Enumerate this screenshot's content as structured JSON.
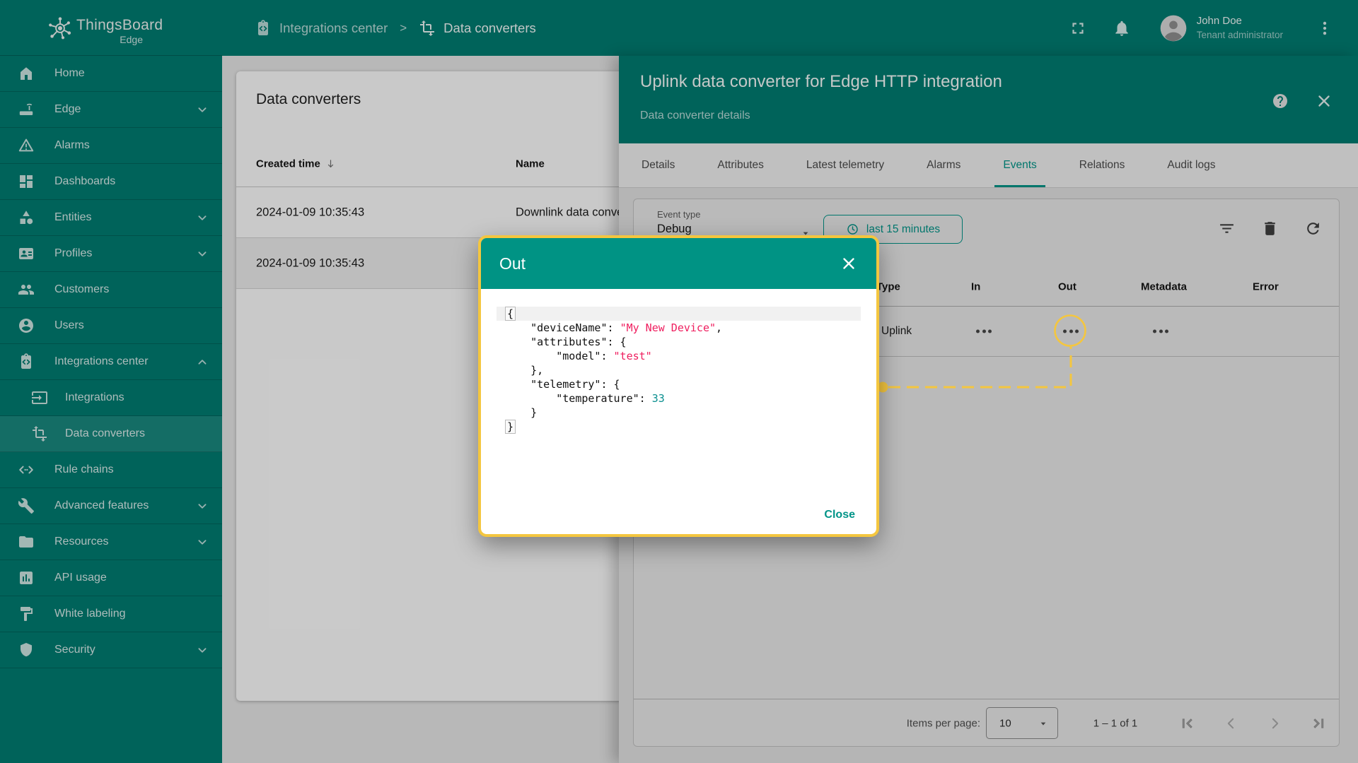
{
  "colors": {
    "primary_teal": "#007c71",
    "accent_teal": "#009488",
    "highlight_yellow": "#f4c63f",
    "json_string_color": "#ef1d5e",
    "json_number_color": "#0a8f8f"
  },
  "sidebar": {
    "logo": {
      "title": "ThingsBoard",
      "subtitle": "Edge"
    },
    "items": [
      {
        "label": "Home",
        "icon": "home"
      },
      {
        "label": "Edge",
        "icon": "edge-device",
        "chevron": "down"
      },
      {
        "label": "Alarms",
        "icon": "warning"
      },
      {
        "label": "Dashboards",
        "icon": "dashboards"
      },
      {
        "label": "Entities",
        "icon": "entities",
        "chevron": "down"
      },
      {
        "label": "Profiles",
        "icon": "profiles",
        "chevron": "down"
      },
      {
        "label": "Customers",
        "icon": "customers"
      },
      {
        "label": "Users",
        "icon": "user"
      },
      {
        "label": "Integrations center",
        "icon": "integrations-center",
        "chevron": "up"
      },
      {
        "label": "Integrations",
        "icon": "integration",
        "sub": true
      },
      {
        "label": "Data converters",
        "icon": "data-converter",
        "sub": true,
        "selected": true
      },
      {
        "label": "Rule chains",
        "icon": "rule-chain"
      },
      {
        "label": "Advanced features",
        "icon": "advanced-features",
        "chevron": "down"
      },
      {
        "label": "Resources",
        "icon": "folder",
        "chevron": "down"
      },
      {
        "label": "API usage",
        "icon": "api-usage"
      },
      {
        "label": "White labeling",
        "icon": "white-labeling"
      },
      {
        "label": "Security",
        "icon": "shield",
        "chevron": "down"
      }
    ]
  },
  "topbar": {
    "breadcrumb": [
      {
        "label": "Integrations center",
        "icon": "integrations-center"
      },
      {
        "label": "Data converters",
        "icon": "data-converter"
      }
    ],
    "separator": ">",
    "user": {
      "name": "John Doe",
      "role": "Tenant administrator"
    }
  },
  "converters": {
    "title": "Data converters",
    "columns": [
      "Created time",
      "Name"
    ],
    "rows": [
      {
        "created": "2024-01-09 10:35:43",
        "name": "Downlink data conve",
        "selected": false
      },
      {
        "created": "2024-01-09 10:35:43",
        "name": "",
        "selected": true
      }
    ]
  },
  "panel": {
    "title": "Uplink data converter for Edge HTTP integration",
    "subtitle": "Data converter details",
    "tabs": [
      {
        "label": "Details"
      },
      {
        "label": "Attributes"
      },
      {
        "label": "Latest telemetry"
      },
      {
        "label": "Alarms"
      },
      {
        "label": "Events",
        "active": true
      },
      {
        "label": "Relations"
      },
      {
        "label": "Audit logs"
      }
    ],
    "filter": {
      "label": "Event type",
      "value": "Debug",
      "time_button": "last 15 minutes"
    },
    "events": {
      "columns": [
        "Type",
        "In",
        "Out",
        "Metadata",
        "Error"
      ],
      "row": {
        "type": "Uplink"
      },
      "ellipsis_icon": "more-horiz"
    },
    "pagination": {
      "label": "Items per page:",
      "page_size": "10",
      "range": "1 – 1 of 1"
    }
  },
  "modal": {
    "title": "Out",
    "close_label": "Close",
    "json_lines": [
      {
        "highlight": true,
        "segments": [
          {
            "cls": "box",
            "text": "{"
          }
        ]
      },
      {
        "segments": [
          {
            "cls": "pl",
            "text": "    \"deviceName\": "
          },
          {
            "cls": "str",
            "text": "\"My New Device\""
          },
          {
            "cls": "pl",
            "text": ","
          }
        ]
      },
      {
        "segments": [
          {
            "cls": "pl",
            "text": "    \"attributes\": {"
          }
        ]
      },
      {
        "segments": [
          {
            "cls": "pl",
            "text": "        \"model\": "
          },
          {
            "cls": "str",
            "text": "\"test\""
          }
        ]
      },
      {
        "segments": [
          {
            "cls": "pl",
            "text": "    },"
          }
        ]
      },
      {
        "segments": [
          {
            "cls": "pl",
            "text": "    \"telemetry\": {"
          }
        ]
      },
      {
        "segments": [
          {
            "cls": "pl",
            "text": "        \"temperature\": "
          },
          {
            "cls": "num",
            "text": "33"
          }
        ]
      },
      {
        "segments": [
          {
            "cls": "pl",
            "text": "    }"
          }
        ]
      },
      {
        "segments": [
          {
            "cls": "box",
            "text": "}"
          }
        ]
      }
    ]
  }
}
